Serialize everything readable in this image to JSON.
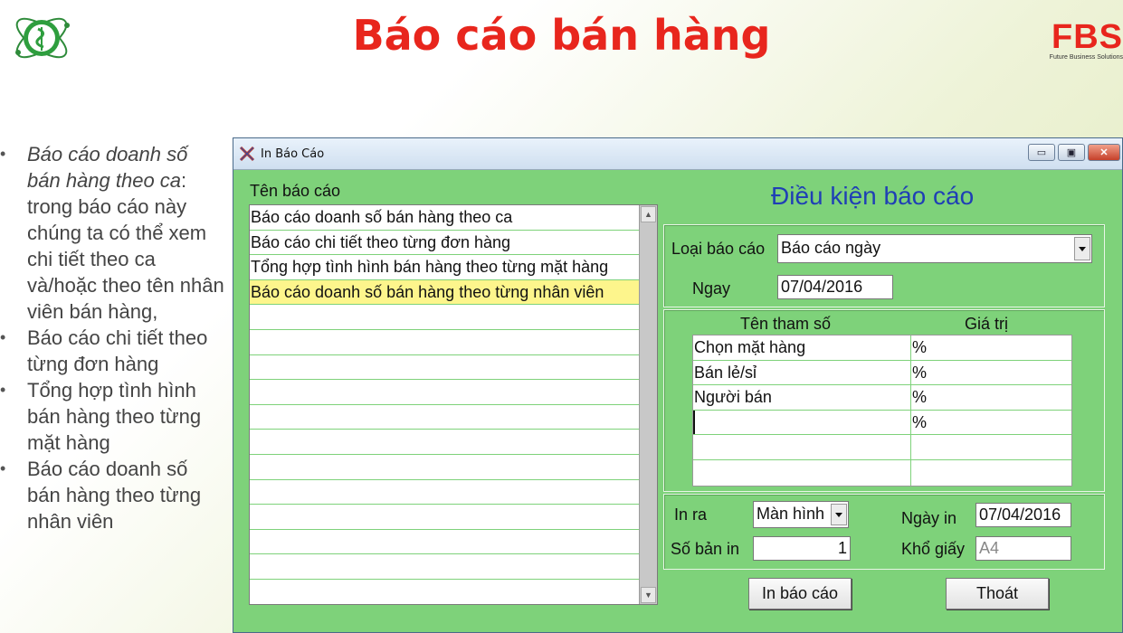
{
  "slide": {
    "title": "Báo cáo bán hàng",
    "brand": "FBS",
    "brand_sub": "Future Business Solutions"
  },
  "bullets": [
    {
      "em": "Báo cáo doanh số bán hàng theo ca",
      "rest": ": trong báo cáo này chúng ta có thể xem chi tiết theo ca và/hoặc theo tên nhân viên bán hàng,"
    },
    {
      "em": "",
      "rest": "Báo cáo chi tiết theo từng đơn hàng"
    },
    {
      "em": "",
      "rest": "Tổng hợp tình hình bán hàng theo từng mặt hàng"
    },
    {
      "em": "",
      "rest": "Báo cáo doanh số bán hàng theo từng nhân viên"
    }
  ],
  "window": {
    "title": "In Báo Cáo",
    "report_list_label": "Tên báo cáo",
    "reports": [
      "Báo cáo doanh số bán hàng theo ca",
      "Báo cáo chi tiết theo từng đơn hàng",
      "Tổng hợp tình hình bán hàng theo từng mặt hàng",
      "Báo cáo doanh số bán hàng theo từng nhân viên"
    ],
    "selected_index": 3,
    "conditions_title": "Điều kiện báo cáo",
    "report_type_label": "Loại báo cáo",
    "report_type_value": "Báo cáo ngày",
    "date_label": "Ngay",
    "date_value": "07/04/2016",
    "param_header": "Tên tham số",
    "value_header": "Giá trị",
    "params": [
      {
        "name": "Chọn mặt hàng",
        "value": "%"
      },
      {
        "name": "Bán lẻ/sỉ",
        "value": "%"
      },
      {
        "name": "Người bán",
        "value": "%"
      },
      {
        "name": "",
        "value": "%"
      },
      {
        "name": "",
        "value": ""
      },
      {
        "name": "",
        "value": ""
      }
    ],
    "output_label": "In ra",
    "output_value": "Màn hình",
    "print_date_label": "Ngày in",
    "print_date_value": "07/04/2016",
    "copies_label": "Số bản in",
    "copies_value": "1",
    "paper_label": "Khổ giấy",
    "paper_value": "A4",
    "print_button": "In báo cáo",
    "exit_button": "Thoát"
  },
  "colors": {
    "title_red": "#e8261d",
    "window_green": "#7ed27a",
    "selected_row": "#fdf58c",
    "heading_blue": "#1f3fb5"
  }
}
